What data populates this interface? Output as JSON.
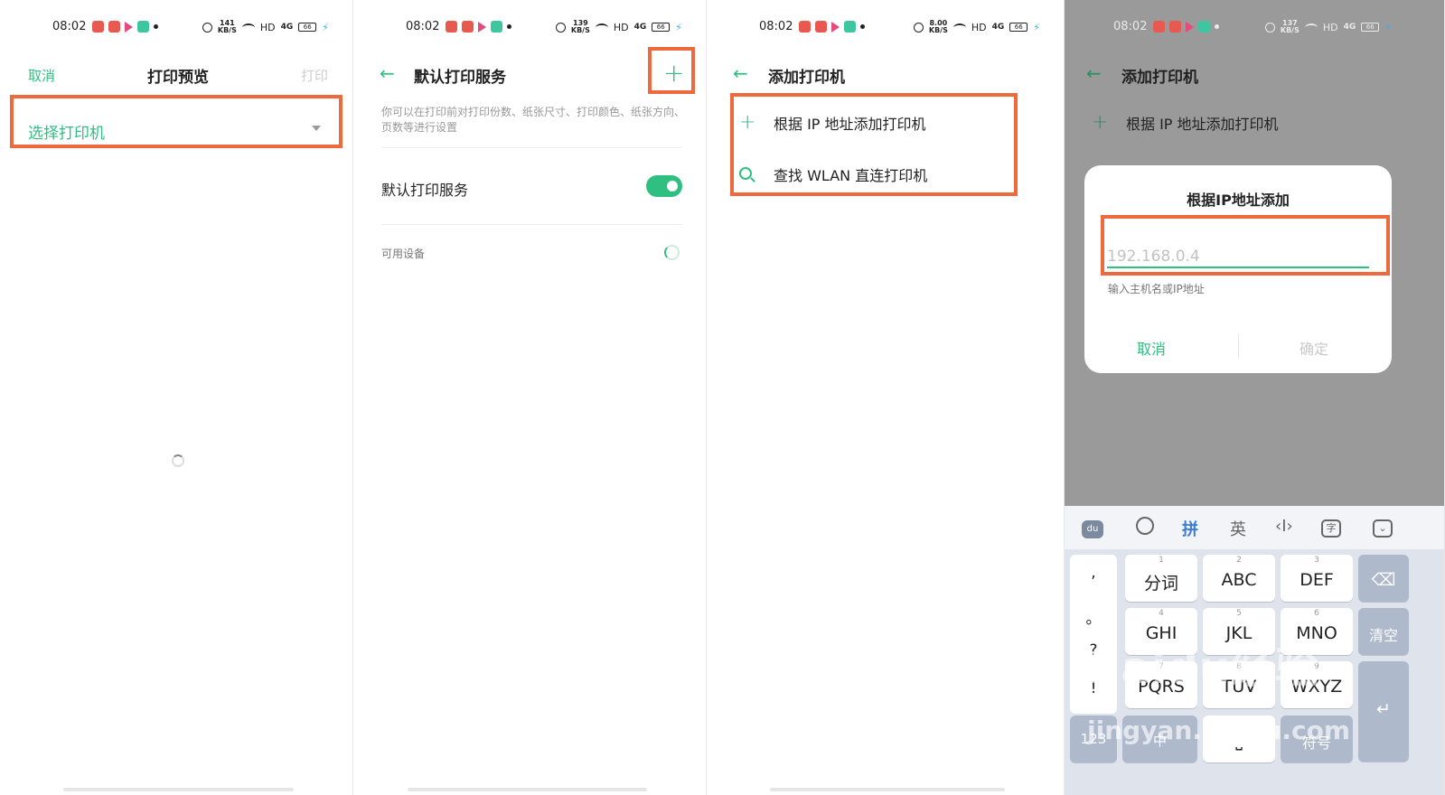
{
  "status_bar": {
    "panels": [
      {
        "time": "08:02",
        "speed": "141",
        "unit": "KB/S",
        "hd": "HD",
        "net": "4G",
        "battery": "66"
      },
      {
        "time": "08:02",
        "speed": "139",
        "unit": "KB/S",
        "hd": "HD",
        "net": "4G",
        "battery": "66"
      },
      {
        "time": "08:02",
        "speed": "8.00",
        "unit": "KB/S",
        "hd": "HD",
        "net": "4G",
        "battery": "66"
      },
      {
        "time": "08:02",
        "speed": "137",
        "unit": "KB/S",
        "hd": "HD",
        "net": "4G",
        "battery": "66"
      }
    ]
  },
  "panel1": {
    "cancel": "取消",
    "title": "打印预览",
    "print": "打印",
    "select_printer": "选择打印机"
  },
  "panel2": {
    "title": "默认打印服务",
    "add": "+",
    "description": "你可以在打印前对打印份数、纸张尺寸、打印颜色、纸张方向、页数等进行设置",
    "default_service_label": "默认打印服务",
    "default_service_on": true,
    "available_devices": "可用设备"
  },
  "panel3": {
    "title": "添加打印机",
    "items": [
      {
        "label": "根据 IP 地址添加打印机",
        "icon": "plus-icon"
      },
      {
        "label": "查找 WLAN 直连打印机",
        "icon": "search-icon"
      }
    ]
  },
  "panel4": {
    "title": "添加打印机",
    "item": "根据 IP 地址添加打印机",
    "dialog": {
      "title": "根据IP地址添加",
      "placeholder": "192.168.0.4",
      "hint": "输入主机名或IP地址",
      "cancel": "取消",
      "confirm": "确定"
    },
    "keyboard": {
      "toolbar": {
        "logo": "du",
        "pinyin": "拼",
        "english": "英"
      },
      "punctuation": [
        ",",
        "。",
        "?",
        "!"
      ],
      "keys": [
        {
          "num": "1",
          "label": "分词"
        },
        {
          "num": "2",
          "label": "ABC"
        },
        {
          "num": "3",
          "label": "DEF"
        },
        {
          "num": "4",
          "label": "GHI"
        },
        {
          "num": "5",
          "label": "JKL"
        },
        {
          "num": "6",
          "label": "MNO"
        },
        {
          "num": "7",
          "label": "PQRS"
        },
        {
          "num": "8",
          "label": "TUV"
        },
        {
          "num": "9",
          "label": "WXYZ"
        }
      ],
      "clear": "清空",
      "num_switch": "123",
      "middle": "中",
      "symbol": "符号"
    },
    "watermark": "Baidu经验",
    "watermark_url": "jingyan.baidu.com"
  },
  "colors": {
    "accent": "#2fbf80",
    "highlight": "#ee6a3c",
    "overlay": "#9a9a9a",
    "keyboard_fn": "#aebacc"
  }
}
